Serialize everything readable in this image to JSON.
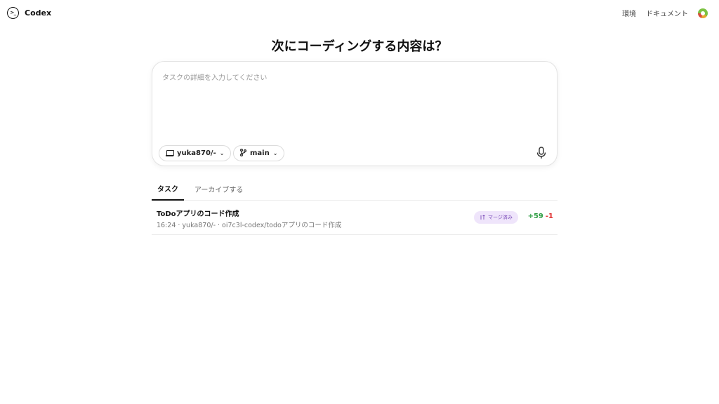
{
  "app": {
    "name": "Codex"
  },
  "nav": {
    "environments": "環境",
    "docs": "ドキュメント"
  },
  "heading": "次にコーディングする内容は？",
  "composer": {
    "placeholder": "タスクの詳細を入力してください",
    "environment": "yuka870/-",
    "branch": "main"
  },
  "tabs": [
    {
      "label": "タスク",
      "active": true
    },
    {
      "label": "アーカイブする",
      "active": false
    }
  ],
  "tasks": [
    {
      "title": "ToDoアプリのコード作成",
      "meta": "16:24 · yuka870/- · oi7c3l-codex/todoアプリのコード作成",
      "status": "マージ済み",
      "additions": "+59",
      "deletions": "-1"
    }
  ],
  "colors": {
    "badge_bg": "#efe5fb",
    "badge_text": "#7a4bb8",
    "additions": "#2f9e44",
    "deletions": "#e03131"
  },
  "icons": {
    "logo": "terminal-prompt-icon",
    "avatar": "user-avatar",
    "environment": "laptop-icon",
    "branch": "git-branch-icon",
    "mic": "microphone-icon",
    "merged": "merge-icon"
  }
}
